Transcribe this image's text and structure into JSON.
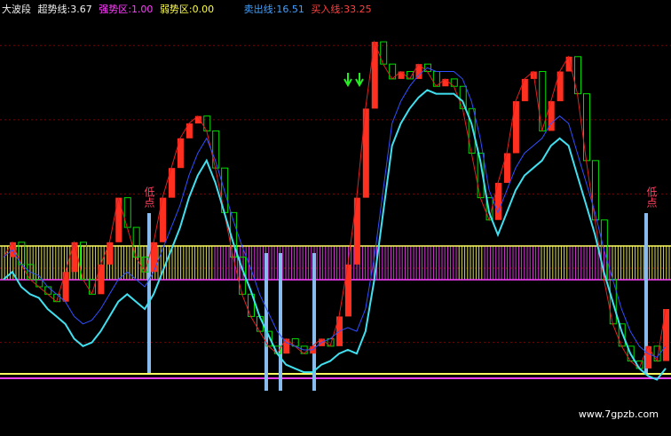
{
  "legend": {
    "title": "大波段",
    "items": [
      {
        "label": "超势线:",
        "value": "3.67",
        "color": "#f0f0f0"
      },
      {
        "label": "强势区:",
        "value": "1.00",
        "color": "#ff40ff"
      },
      {
        "label": "弱势区:",
        "value": "0.00",
        "color": "#ffff40"
      },
      {
        "label": "卖出线:",
        "value": "16.51",
        "color": "#40a0ff"
      },
      {
        "label": "买入线:",
        "value": "33.25",
        "color": "#ff4040"
      }
    ]
  },
  "annotations": [
    "低点",
    "低点"
  ],
  "watermark": "www.7gpzb.com",
  "colors": {
    "background": "#000000",
    "grid": "#800000",
    "candle_up": "#ff3020",
    "candle_box": "#00dd00",
    "cyan_line": "#40e0f0",
    "blue_line": "#3050ff",
    "red_line": "#e02020",
    "magenta_band": "#ff40ff",
    "yellow_band": "#ffff60",
    "signal_bar": "#88bbee",
    "arrow": "#22ee22"
  },
  "chart_data": {
    "type": "line",
    "note_units": "indicator value",
    "ylim": [
      0,
      100
    ],
    "grid": "dashed horizontal",
    "bands": {
      "strong_zone_value": 1.0,
      "weak_zone_value": 0.0
    },
    "cyan_series": [
      30,
      32,
      28,
      26,
      25,
      22,
      20,
      18,
      14,
      12,
      13,
      16,
      20,
      24,
      26,
      24,
      22,
      26,
      32,
      38,
      44,
      52,
      58,
      62,
      56,
      48,
      40,
      33,
      27,
      20,
      15,
      10,
      7,
      6,
      5,
      5,
      7,
      8,
      10,
      11,
      10,
      16,
      30,
      48,
      66,
      72,
      76,
      79,
      81,
      80,
      80,
      80,
      78,
      72,
      62,
      48,
      42,
      48,
      54,
      58,
      60,
      62,
      66,
      68,
      66,
      58,
      50,
      42,
      32,
      24,
      16,
      10,
      6,
      4,
      3,
      6
    ],
    "red_series": [
      36,
      40,
      34,
      30,
      28,
      26,
      24,
      32,
      40,
      30,
      26,
      34,
      40,
      52,
      44,
      36,
      32,
      40,
      52,
      60,
      68,
      72,
      74,
      70,
      60,
      48,
      36,
      26,
      20,
      16,
      12,
      10,
      14,
      12,
      10,
      12,
      14,
      12,
      20,
      34,
      52,
      76,
      94,
      88,
      84,
      86,
      84,
      88,
      86,
      82,
      84,
      82,
      76,
      64,
      52,
      46,
      56,
      64,
      78,
      84,
      86,
      70,
      78,
      86,
      90,
      80,
      62,
      46,
      30,
      18,
      12,
      8,
      6,
      12,
      8,
      22
    ],
    "signal_bars": [
      "低点",
      "",
      "",
      "",
      "低点"
    ]
  }
}
